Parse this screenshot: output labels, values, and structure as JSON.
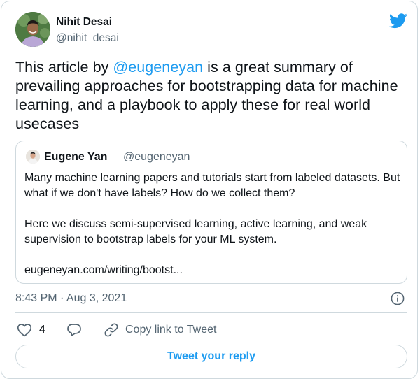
{
  "author": {
    "name": "Nihit Desai",
    "handle": "@nihit_desai"
  },
  "tweet": {
    "text_before": "This article by ",
    "mention": "@eugeneyan",
    "text_after": " is a great summary of prevailing approaches for bootstrapping data for machine learning, and a playbook to apply these for real world usecases"
  },
  "quoted_tweet": {
    "name": "Eugene Yan",
    "handle": "@eugeneyan",
    "paragraph_1": "Many machine learning papers and tutorials start from labeled datasets. But what if we don't have labels? How do we collect them?",
    "paragraph_2": "Here we discuss semi-supervised learning, active learning, and weak supervision to bootstrap labels for your ML system.",
    "link": "eugeneyan.com/writing/bootst..."
  },
  "timestamp": "8:43 PM · Aug 3, 2021",
  "actions": {
    "like_count": "4",
    "copy_link_label": "Copy link to Tweet"
  },
  "reply_button_label": "Tweet your reply",
  "icons": {
    "twitter_logo": "twitter-bird-icon",
    "info": "info-icon",
    "like": "heart-icon",
    "reply": "speech-bubble-icon",
    "copy_link": "link-icon"
  },
  "colors": {
    "accent": "#1d9bf0",
    "secondary_text": "#536471",
    "border": "#cfd9de"
  }
}
